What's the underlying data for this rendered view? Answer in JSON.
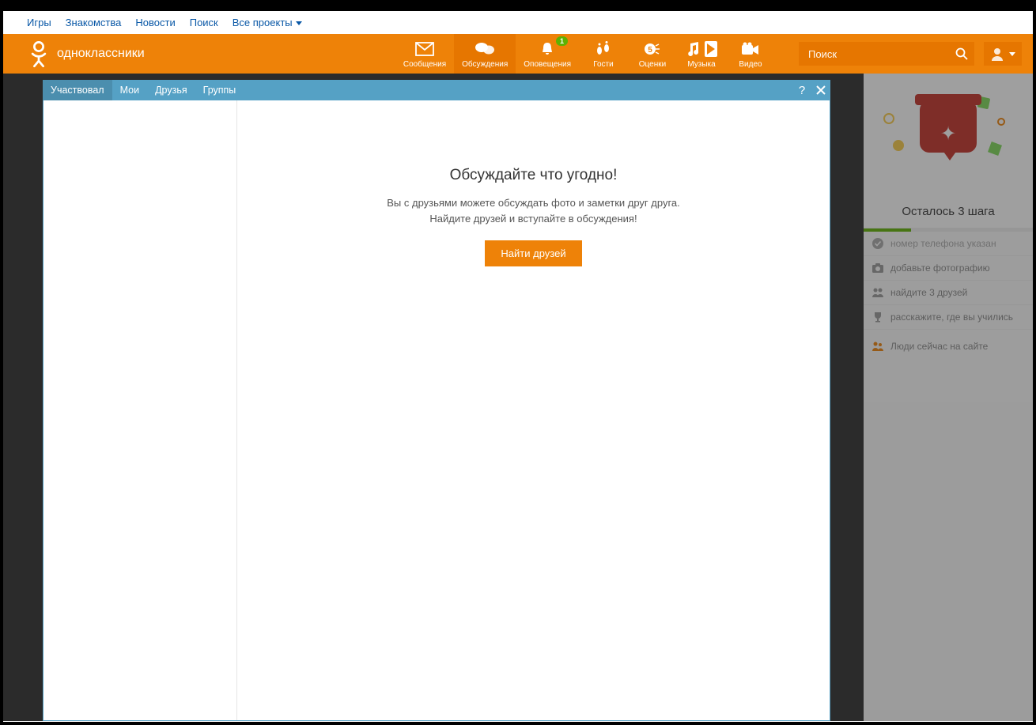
{
  "top_links": [
    "Игры",
    "Знакомства",
    "Новости",
    "Поиск",
    "Все проекты"
  ],
  "brand": "одноклассники",
  "nav": [
    {
      "label": "Сообщения"
    },
    {
      "label": "Обсуждения"
    },
    {
      "label": "Оповещения",
      "badge": "1"
    },
    {
      "label": "Гости"
    },
    {
      "label": "Оценки"
    },
    {
      "label": "Музыка"
    },
    {
      "label": "Видео"
    }
  ],
  "search_placeholder": "Поиск",
  "modal_tabs": [
    "Участвовал",
    "Мои",
    "Друзья",
    "Группы"
  ],
  "empty": {
    "title": "Обсуждайте что угодно!",
    "line1": "Вы с друзьями можете обсуждать фото и заметки друг друга.",
    "line2": "Найдите друзей и вступайте в обсуждения!",
    "button": "Найти друзей"
  },
  "sidebar": {
    "steps_title": "Осталось 3 шага",
    "steps": [
      {
        "label": "номер телефона указан",
        "done": true
      },
      {
        "label": "добавьте фотографию",
        "done": false
      },
      {
        "label": "найдите 3 друзей",
        "done": false
      },
      {
        "label": "расскажите, где вы учились",
        "done": false
      }
    ],
    "online_title": "Люди сейчас на сайте"
  }
}
